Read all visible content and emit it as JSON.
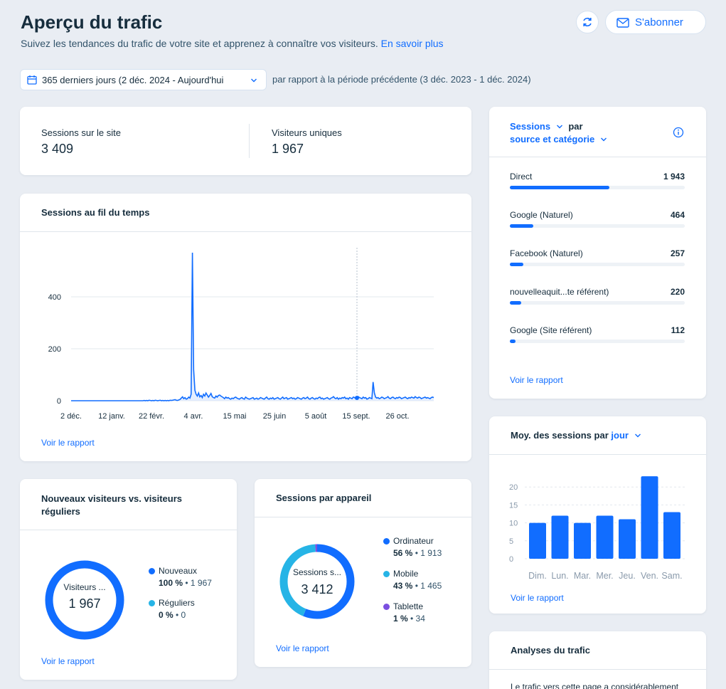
{
  "header": {
    "title": "Aperçu du trafic",
    "subtitle": "Suivez les tendances du trafic de votre site et apprenez à connaître vos visiteurs.",
    "learn_more": "En savoir plus",
    "subscribe_label": "S'abonner",
    "date_range": "365 derniers jours (2 déc. 2024 - Aujourd'hui",
    "comparison": "par rapport à la période précédente (3 déc. 2023 - 1 déc. 2024)"
  },
  "kpis": {
    "sessions_label": "Sessions sur le site",
    "sessions_value": "3 409",
    "visitors_label": "Visiteurs uniques",
    "visitors_value": "1 967"
  },
  "sessions_time": {
    "title": "Sessions au fil du temps",
    "link": "Voir le rapport"
  },
  "sources": {
    "metric": "Sessions",
    "by": "par",
    "dimension": "source et catégorie",
    "link": "Voir le rapport",
    "max": 1943,
    "items": [
      {
        "label": "Direct",
        "value": "1 943",
        "n": 1943
      },
      {
        "label": "Google (Naturel)",
        "value": "464",
        "n": 464
      },
      {
        "label": "Facebook (Naturel)",
        "value": "257",
        "n": 257
      },
      {
        "label": "nouvelleaquit...te référent)",
        "value": "220",
        "n": 220
      },
      {
        "label": "Google (Site référent)",
        "value": "112",
        "n": 112
      }
    ]
  },
  "avg_sessions": {
    "title": "Moy. des sessions par",
    "dimension": "jour",
    "link": "Voir le rapport"
  },
  "new_vs_returning": {
    "title_line1": "Nouveaux visiteurs vs. visiteurs",
    "title_line2": "réguliers",
    "center_label": "Visiteurs ...",
    "center_value": "1 967",
    "legend": [
      {
        "name": "Nouveaux",
        "pct": "100 %",
        "count": "1 967",
        "color": "#116dff"
      },
      {
        "name": "Réguliers",
        "pct": "0 %",
        "count": "0",
        "color": "#26b4e6"
      }
    ],
    "link": "Voir le rapport"
  },
  "devices": {
    "title": "Sessions par appareil",
    "center_label": "Sessions s...",
    "center_value": "3 412",
    "legend": [
      {
        "name": "Ordinateur",
        "pct": "56 %",
        "count": "1 913",
        "color": "#116dff"
      },
      {
        "name": "Mobile",
        "pct": "43 %",
        "count": "1 465",
        "color": "#26b4e6"
      },
      {
        "name": "Tablette",
        "pct": "1 %",
        "count": "34",
        "color": "#7b4fe0"
      }
    ],
    "link": "Voir le rapport"
  },
  "analysis": {
    "title": "Analyses du trafic",
    "text": "Le trafic vers cette page a considérablement"
  },
  "chart_data": [
    {
      "type": "line",
      "title": "Sessions au fil du temps",
      "x_ticks": [
        "2 déc.",
        "12 janv.",
        "22 févr.",
        "4 avr.",
        "15 mai",
        "25 juin",
        "5 août",
        "15 sept.",
        "26 oct."
      ],
      "y_ticks": [
        0,
        200,
        400
      ],
      "ylim": [
        0,
        600
      ],
      "series": [
        {
          "values": [
            0,
            0,
            0,
            0,
            0,
            0,
            0,
            0,
            0,
            0,
            0,
            0,
            0,
            0,
            0,
            0,
            0,
            0,
            0,
            0,
            0,
            0,
            0,
            0,
            0,
            0,
            0,
            0,
            0,
            0,
            0,
            0,
            0,
            0,
            0,
            0,
            0,
            0,
            0,
            0,
            0,
            0,
            0,
            0,
            0,
            0,
            0,
            0,
            0,
            0,
            0,
            0,
            0,
            0,
            0,
            0,
            0,
            0,
            0,
            1,
            0,
            1,
            0,
            2,
            1,
            0,
            1,
            0,
            2,
            1,
            0,
            1,
            2,
            0,
            1,
            0,
            1,
            0,
            1,
            0,
            2,
            1,
            2,
            3,
            4,
            2,
            1,
            3,
            5,
            10,
            15,
            8,
            12,
            6,
            8,
            14,
            10,
            25,
            570,
            120,
            40,
            25,
            18,
            30,
            15,
            20,
            12,
            25,
            18,
            30,
            22,
            14,
            20,
            28,
            16,
            12,
            10,
            18,
            14,
            20,
            22,
            18,
            15,
            12,
            8,
            14,
            10,
            12,
            8,
            6,
            10,
            8,
            12,
            14,
            10,
            8,
            6,
            10,
            12,
            8,
            6,
            14,
            10,
            8,
            6,
            8,
            10,
            12,
            6,
            8,
            10,
            6,
            8,
            12,
            10,
            8,
            6,
            10,
            14,
            8,
            6,
            10,
            8,
            12,
            6,
            8,
            10,
            12,
            8,
            6,
            10,
            14,
            8,
            10,
            12,
            6,
            8,
            10,
            12,
            8,
            10,
            6,
            8,
            12,
            10,
            8,
            6,
            10,
            12,
            8,
            10,
            14,
            8,
            6,
            10,
            12,
            8,
            6,
            10,
            8,
            12,
            14,
            8,
            10,
            6,
            8,
            10,
            12,
            8,
            6,
            10,
            12,
            16,
            10,
            8,
            12,
            6,
            10,
            8,
            12,
            10,
            14,
            8,
            10,
            6,
            12,
            10,
            8,
            14,
            12,
            8,
            10,
            16,
            12,
            10,
            8,
            14,
            10,
            12,
            6,
            8,
            12,
            10,
            8,
            72,
            30,
            14,
            10,
            12,
            8,
            10,
            14,
            12,
            8,
            10,
            12,
            16,
            10,
            8,
            12,
            14,
            10,
            8,
            12,
            10,
            14,
            12,
            8,
            10,
            12,
            14,
            10,
            8,
            12,
            10,
            14,
            12,
            10,
            16,
            12,
            10,
            14,
            12,
            8,
            10,
            12,
            14,
            10,
            12,
            10,
            8,
            12,
            14,
            12
          ]
        }
      ]
    },
    {
      "type": "bar",
      "title": "Moy. des sessions par jour",
      "categories": [
        "Dim.",
        "Lun.",
        "Mar.",
        "Mer.",
        "Jeu.",
        "Ven.",
        "Sam."
      ],
      "values": [
        10,
        12,
        10,
        12,
        11,
        23,
        13
      ],
      "y_ticks": [
        0,
        5,
        10,
        15,
        20
      ],
      "ylim": [
        0,
        25
      ]
    },
    {
      "type": "pie",
      "title": "Nouveaux visiteurs vs. visiteurs réguliers",
      "categories": [
        "Nouveaux",
        "Réguliers"
      ],
      "values": [
        1967,
        0
      ]
    },
    {
      "type": "pie",
      "title": "Sessions par appareil",
      "categories": [
        "Ordinateur",
        "Mobile",
        "Tablette"
      ],
      "values": [
        1913,
        1465,
        34
      ]
    }
  ],
  "colors": {
    "accent": "#116dff",
    "cyan": "#26b4e6",
    "purple": "#7b4fe0"
  }
}
